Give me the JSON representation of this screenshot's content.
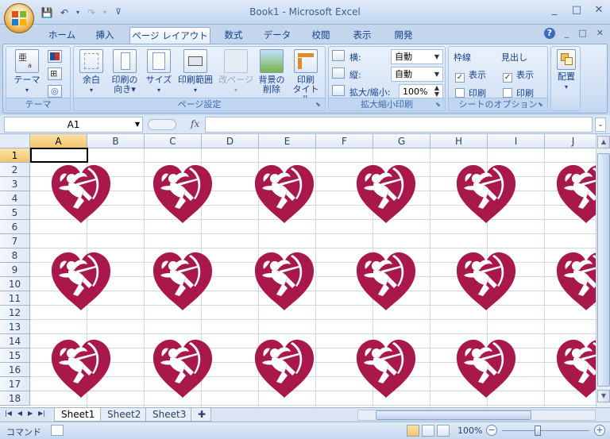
{
  "app": {
    "title": "Book1 - Microsoft Excel",
    "qat_icons": [
      "save-icon",
      "undo-icon",
      "redo-icon",
      "customize-icon"
    ],
    "window_controls": [
      "_",
      "□",
      "✕"
    ],
    "ribbon_controls": [
      "?",
      "_",
      "□",
      "✕"
    ]
  },
  "tabs": [
    "ホーム",
    "挿入",
    "ページ レイアウト",
    "数式",
    "データ",
    "校閲",
    "表示",
    "開発"
  ],
  "active_tab": "ページ レイアウト",
  "ribbon": {
    "theme": {
      "label": "テーマ",
      "button": "テーマ"
    },
    "page_setup": {
      "label": "ページ設定",
      "margins": "余白",
      "orientation": [
        "印刷の",
        "向き"
      ],
      "size": "サイズ",
      "print_area": "印刷範囲",
      "page_break": "改ページ",
      "delete_bg": [
        "背景の",
        "削除"
      ],
      "print_titles": [
        "印刷",
        "タイトル"
      ]
    },
    "scale": {
      "label": "拡大縮小印刷",
      "width_label": "横:",
      "width_value": "自動",
      "height_label": "縦:",
      "height_value": "自動",
      "scale_label": "拡大/縮小:",
      "scale_value": "100%"
    },
    "sheet_options": {
      "label": "シートのオプション",
      "gridlines": "枠線",
      "headings": "見出し",
      "view": "表示",
      "print": "印刷",
      "gridlines_view": true,
      "gridlines_print": false,
      "headings_view": true,
      "headings_print": false
    },
    "arrange": {
      "button": "配置"
    }
  },
  "formula_bar": {
    "name_box": "A1",
    "fx": "fx",
    "formula": ""
  },
  "columns": [
    "A",
    "B",
    "C",
    "D",
    "E",
    "F",
    "G",
    "H",
    "I",
    "J"
  ],
  "rows": [
    "1",
    "2",
    "3",
    "4",
    "5",
    "6",
    "7",
    "8",
    "9",
    "10",
    "11",
    "12",
    "13",
    "14",
    "15",
    "16",
    "17",
    "18"
  ],
  "selected_cell": "A1",
  "background_image": {
    "name": "cupid-heart",
    "color": "#a8184a"
  },
  "sheets": [
    "Sheet1",
    "Sheet2",
    "Sheet3"
  ],
  "active_sheet": "Sheet1",
  "status": {
    "mode": "コマンド",
    "zoom": "100%"
  }
}
